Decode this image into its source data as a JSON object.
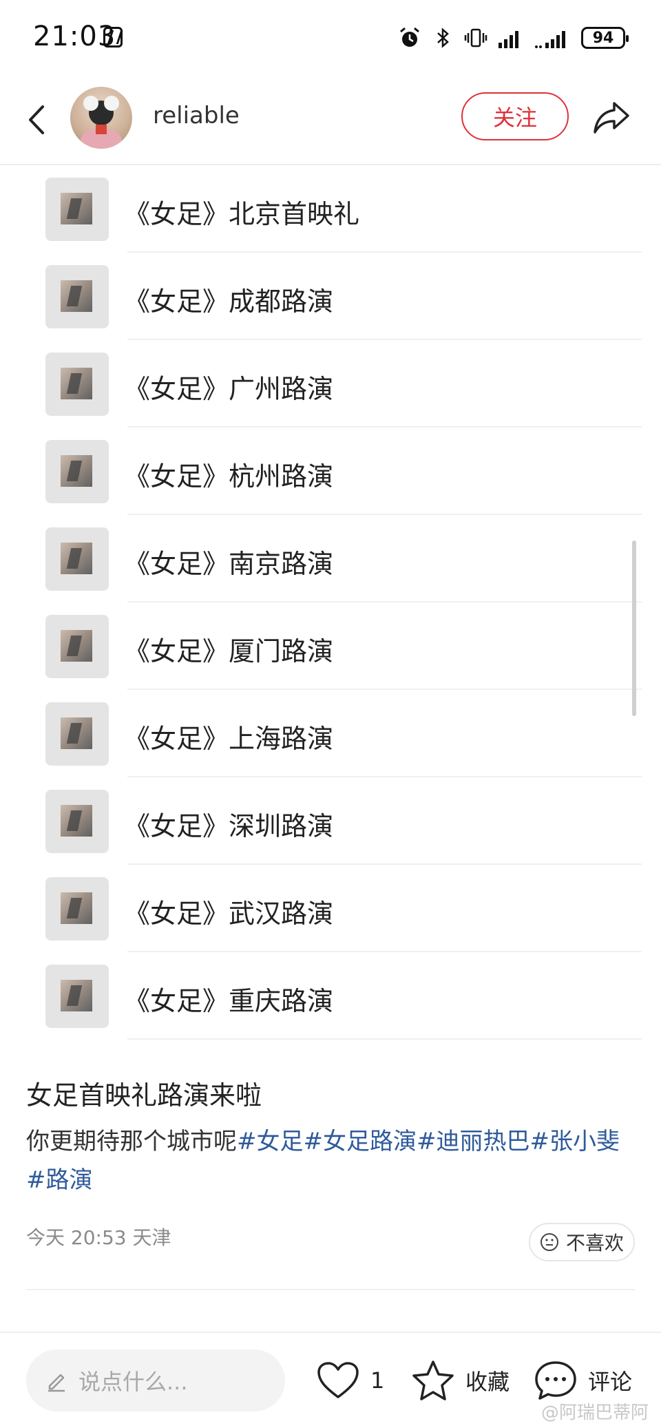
{
  "status_bar": {
    "time": "21:03",
    "battery": "94",
    "icons": [
      "nfc-icon",
      "alarm-icon",
      "bluetooth-icon",
      "vibrate-icon",
      "signal-icon",
      "signal-icon-2"
    ]
  },
  "header": {
    "username": "reliable",
    "follow_label": "关注",
    "icons": [
      "back-icon",
      "share-icon"
    ]
  },
  "playlist": [
    {
      "title": "《女足》北京首映礼"
    },
    {
      "title": "《女足》成都路演"
    },
    {
      "title": "《女足》广州路演"
    },
    {
      "title": "《女足》杭州路演"
    },
    {
      "title": "《女足》南京路演"
    },
    {
      "title": "《女足》厦门路演"
    },
    {
      "title": "《女足》上海路演"
    },
    {
      "title": "《女足》深圳路演"
    },
    {
      "title": "《女足》武汉路演"
    },
    {
      "title": "《女足》重庆路演"
    }
  ],
  "post": {
    "title": "女足首映礼路演来啦",
    "body_text": "你更期待那个城市呢",
    "tags": [
      "#女足",
      "#女足路演",
      "#迪丽热巴",
      "#张小斐",
      "#路演"
    ],
    "time": "今天 20:53",
    "location": "天津",
    "dislike_label": "不喜欢"
  },
  "bottom_bar": {
    "comment_placeholder": "说点什么...",
    "like_count": "1",
    "favorite_label": "收藏",
    "comment_label": "评论"
  },
  "watermark": "@阿瑞巴蒂阿",
  "colors": {
    "accent_red": "#e0303a",
    "tag_blue": "#2e5a9c"
  }
}
